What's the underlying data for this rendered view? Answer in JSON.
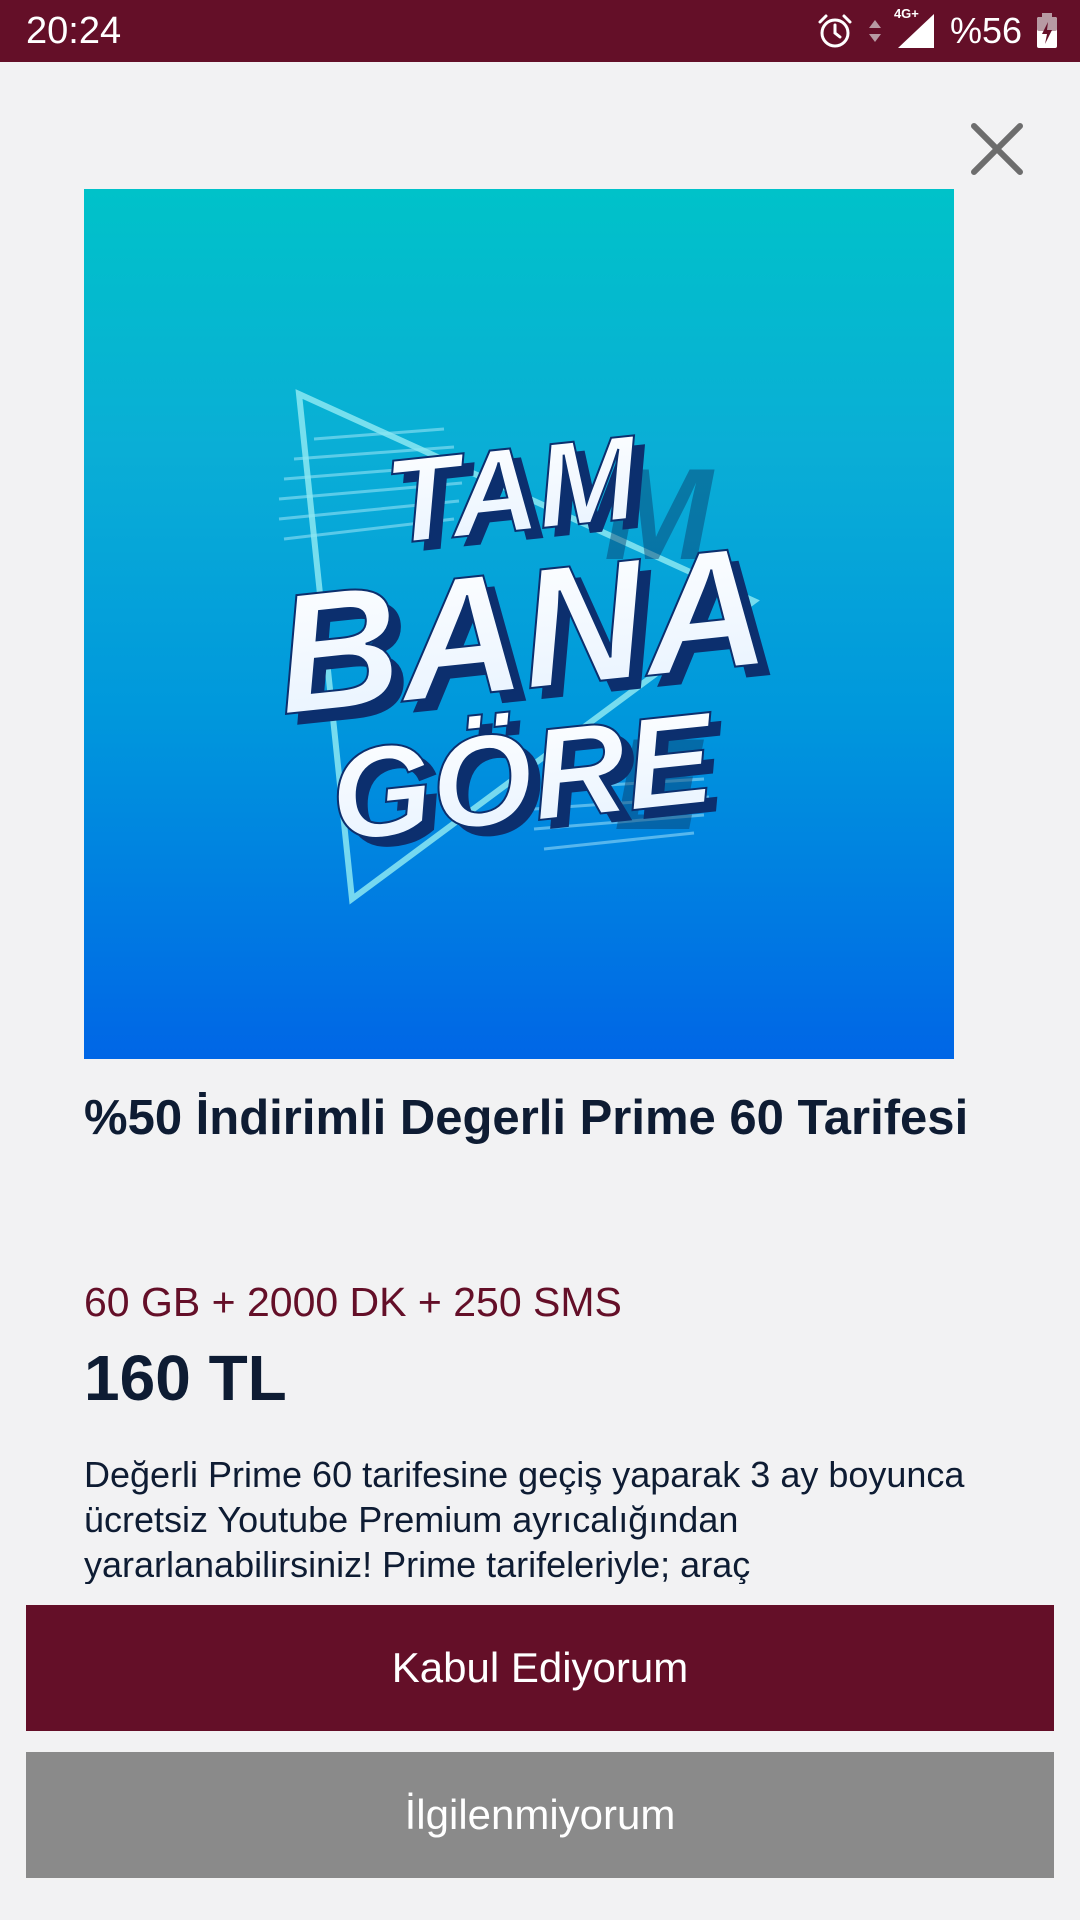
{
  "status_bar": {
    "time": "20:24",
    "network": "4G+",
    "battery": "%56",
    "icons": [
      "alarm-icon",
      "data-arrows-icon",
      "signal-icon",
      "battery-charging-icon"
    ]
  },
  "colors": {
    "brand": "#640f28",
    "secondary_button": "#8a8a8a",
    "title_text": "#0e1c33",
    "background": "#f2f2f3"
  },
  "promo": {
    "image_text": [
      "TAM",
      "BANA",
      "GÖRE"
    ]
  },
  "offer": {
    "title": "%50 İndirimli Degerli Prime 60 Tarifesi",
    "package": "60 GB + 2000 DK + 250 SMS",
    "price": "160 TL",
    "description": "Değerli Prime 60 tarifesine geçiş yaparak 3 ay boyunca ücretsiz Youtube Premium ayrıcalığından yararlanabilirsiniz! Prime tarifeleriyle; araç"
  },
  "buttons": {
    "accept": "Kabul Ediyorum",
    "decline": "İlgilenmiyorum",
    "close_icon": "close-icon"
  }
}
